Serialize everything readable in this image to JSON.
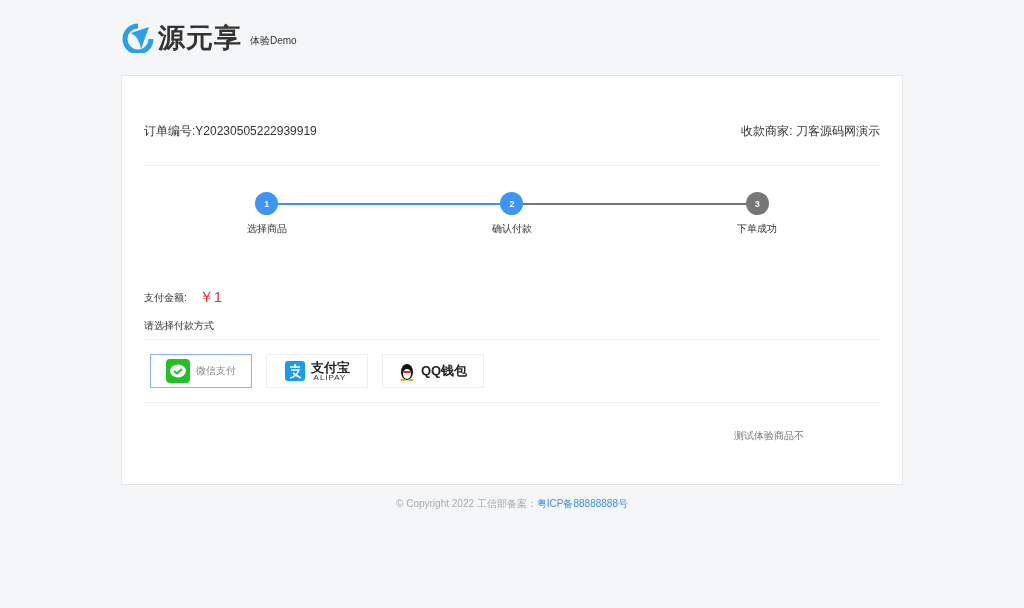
{
  "header": {
    "logo_text": "源元享",
    "badge": "体验Demo"
  },
  "order": {
    "number": "订单编号:Y20230505222939919",
    "merchant": "收款商家: 刀客源码网演示"
  },
  "steps": [
    {
      "number": "1",
      "label": "选择商品",
      "active": true
    },
    {
      "number": "2",
      "label": "确认付款",
      "active": true
    },
    {
      "number": "3",
      "label": "下单成功",
      "active": false
    }
  ],
  "amount": {
    "label": "支付金额:",
    "value": "￥1"
  },
  "payment": {
    "title": "请选择付款方式",
    "methods": [
      {
        "kind": "wechat",
        "label": "微信支付",
        "selected": true
      },
      {
        "kind": "alipay",
        "label": "支付宝",
        "sublabel": "ALIPAY",
        "selected": false
      },
      {
        "kind": "qq",
        "label": "QQ钱包",
        "selected": false
      }
    ]
  },
  "notice": "测试体验商品不",
  "footer": {
    "copyright": "© Copyright 2022",
    "record_label": "工信部备案：",
    "record_link": "粤ICP备88888888号"
  }
}
